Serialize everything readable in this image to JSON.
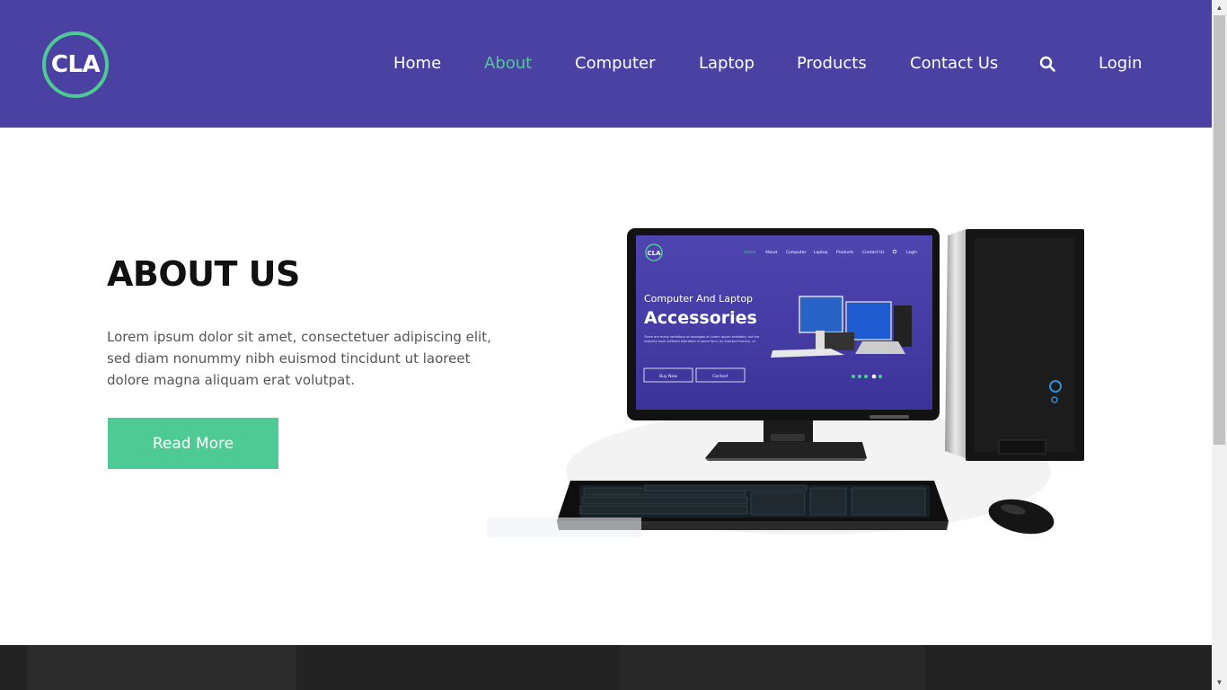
{
  "header": {
    "logo_text": "CLA",
    "nav": [
      {
        "label": "Home",
        "active": false
      },
      {
        "label": "About",
        "active": true
      },
      {
        "label": "Computer",
        "active": false
      },
      {
        "label": "Laptop",
        "active": false
      },
      {
        "label": "Products",
        "active": false
      },
      {
        "label": "Contact Us",
        "active": false
      }
    ],
    "search_icon": "search-icon",
    "login_label": "Login"
  },
  "about": {
    "title": "ABOUT US",
    "text": "Lorem ipsum dolor sit amet, consectetuer adipiscing elit, sed diam nonummy nibh euismod tincidunt ut laoreet dolore magna aliquam erat volutpat.",
    "button_label": "Read More"
  },
  "screen": {
    "logo_text": "CLA",
    "nav": [
      "Home",
      "About",
      "Computer",
      "Laptop",
      "Products",
      "Contact Us",
      "Login"
    ],
    "heading_small": "Computer And Laptop",
    "heading_big": "Accessories",
    "body_text": "There are many variations of passages of Lorem Ipsum available, but the majority have suffered alteration in some form, by injected humour, or",
    "buy_now": "Buy Now",
    "contact": "Contact"
  },
  "colors": {
    "header_bg": "#4a41a2",
    "accent": "#4ecb94",
    "footer_bg": "#232324"
  }
}
